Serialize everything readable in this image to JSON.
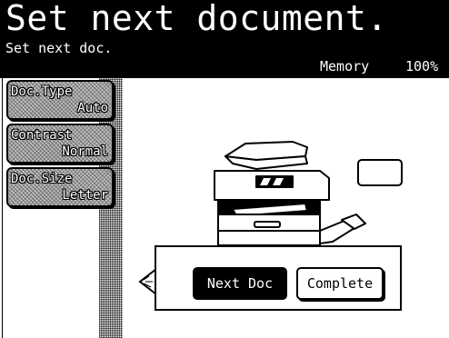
{
  "header": {
    "title": "Set next document.",
    "subtitle": "Set next doc.",
    "memory_label": "Memory",
    "memory_value": "100%"
  },
  "sidebar": {
    "buttons": [
      {
        "label": "Doc.Type",
        "value": "Auto"
      },
      {
        "label": "Contrast",
        "value": "Normal"
      },
      {
        "label": "Doc.Size",
        "value": "Letter"
      }
    ]
  },
  "dialog": {
    "next_doc_label": "Next Doc",
    "complete_label": "Complete"
  },
  "icons": [
    "machine-icon",
    "display-panel-icon",
    "dialog-pointer-icon"
  ],
  "colors": {
    "background": "#ffffff",
    "header": "#000000",
    "text": "#000000"
  }
}
